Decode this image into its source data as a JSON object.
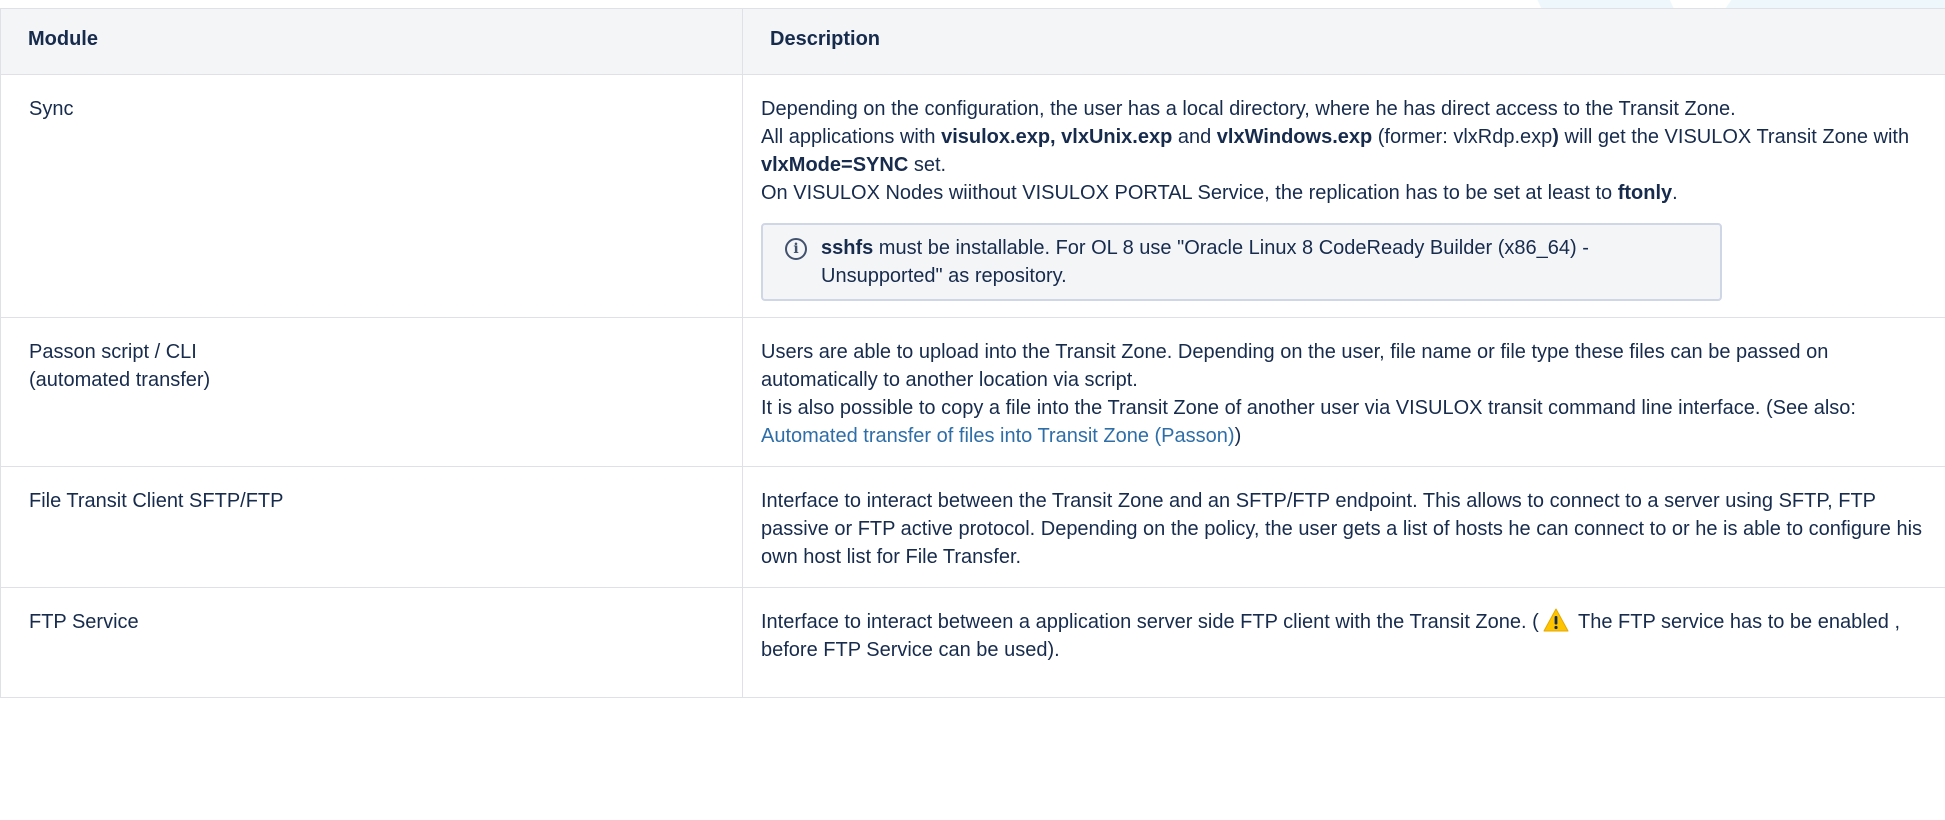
{
  "table": {
    "headers": {
      "module": "Module",
      "description": "Description"
    },
    "rows": [
      {
        "module": "Sync",
        "description": {
          "l1": "Depending on the configuration, the user has a local directory, where he has direct access to the Transit Zone.",
          "l2_a": "All applications with ",
          "l2_b": "visulox.exp, vlxUnix.exp",
          "l2_c": " and ",
          "l2_d": "vlxWindows.exp",
          "l2_e": " (former: vlxRdp.exp",
          "l2_f": ")",
          "l2_g": " will get the VISULOX Transit Zone with ",
          "l2_h": "vlxMode=SYNC",
          "l2_i": " set.",
          "l3_a": "On VISULOX Nodes wiithout VISULOX PORTAL Service, the replication has to be set at least to ",
          "l3_b": "ftonly",
          "l3_c": "."
        },
        "info": {
          "icon": "info-icon",
          "bold": "sshfs",
          "text": " must be installable. For OL 8 use \"Oracle Linux 8 CodeReady Builder (x86_64) - Unsupported\" as repository."
        }
      },
      {
        "module_l1": "Passon script / CLI",
        "module_l2": "(automated transfer)",
        "description": {
          "l1": "Users are able to upload into the Transit Zone. Depending on the user, file name or file type these files can be passed on automatically to another location via script.",
          "l2_a": "It is also possible to copy a file into the Transit Zone of another user via VISULOX transit command line interface. (See also: ",
          "l2_link": "Automated transfer of files into Transit Zone (Passon)",
          "l2_b": ")"
        }
      },
      {
        "module": "File Transit Client SFTP/FTP",
        "description": "Interface to interact between the Transit Zone and an SFTP/FTP endpoint. This allows to connect to a server using SFTP, FTP passive or FTP active protocol. Depending on the policy, the user gets a list of hosts he can connect to or he is able to configure his own host list for File Transfer."
      },
      {
        "module": "FTP Service",
        "description": {
          "a": "Interface to interact between a application server side FTP client with the Transit Zone. (",
          "icon": "warning-icon",
          "b": " The FTP service has to be enabled , before FTP Service can be used)."
        }
      }
    ]
  },
  "colors": {
    "header_bg": "#f4f5f7",
    "border": "#dfe1e6",
    "link": "#2d6ea8",
    "warning": "#ffc400"
  }
}
